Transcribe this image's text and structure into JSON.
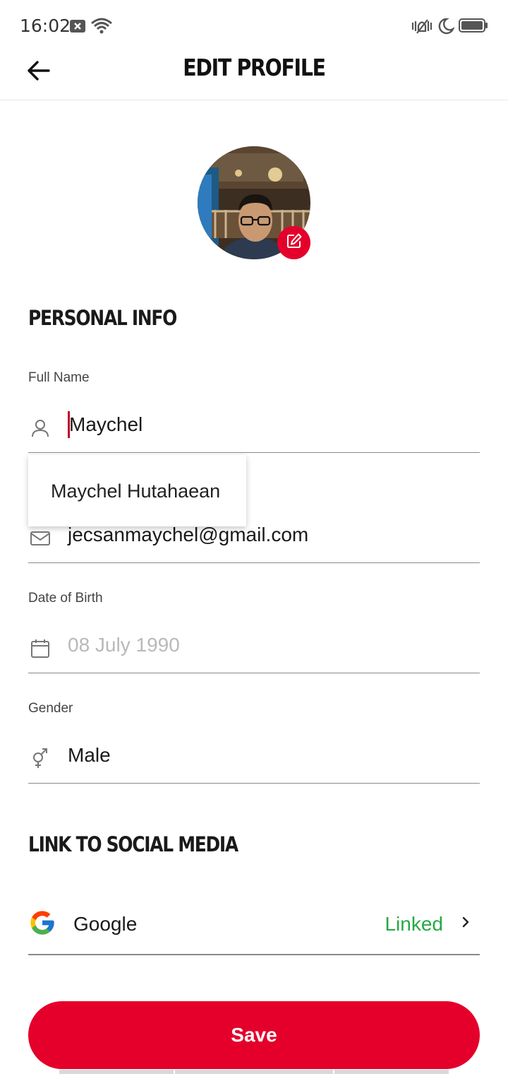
{
  "status_bar": {
    "time": "16:02",
    "left_icons": [
      "notification-x-icon",
      "wifi-icon"
    ],
    "right_icons": [
      "vibrate-icon",
      "moon-icon",
      "battery-icon"
    ]
  },
  "header": {
    "title": "EDIT PROFILE",
    "back_icon": "arrow-left-icon"
  },
  "avatar": {
    "edit_icon": "edit-icon",
    "edit_color": "#e4002b"
  },
  "personal_info": {
    "section_title": "PERSONAL INFO",
    "full_name": {
      "label": "Full Name",
      "value": "Maychel",
      "icon": "user-icon"
    },
    "email": {
      "value": "jecsanmaychel@gmail.com",
      "icon": "mail-icon"
    },
    "date_of_birth": {
      "label": "Date of Birth",
      "value": "08 July 1990",
      "icon": "calendar-icon"
    },
    "gender": {
      "label": "Gender",
      "value": "Male",
      "icon": "gender-icon"
    }
  },
  "autocomplete": {
    "suggestion": "Maychel Hutahaean"
  },
  "social": {
    "section_title": "LINK TO SOCIAL MEDIA",
    "items": [
      {
        "name": "Google",
        "status": "Linked",
        "icon": "google-icon"
      }
    ],
    "linked_color": "#27a844"
  },
  "actions": {
    "save_label": "Save",
    "save_color": "#e4002b"
  }
}
